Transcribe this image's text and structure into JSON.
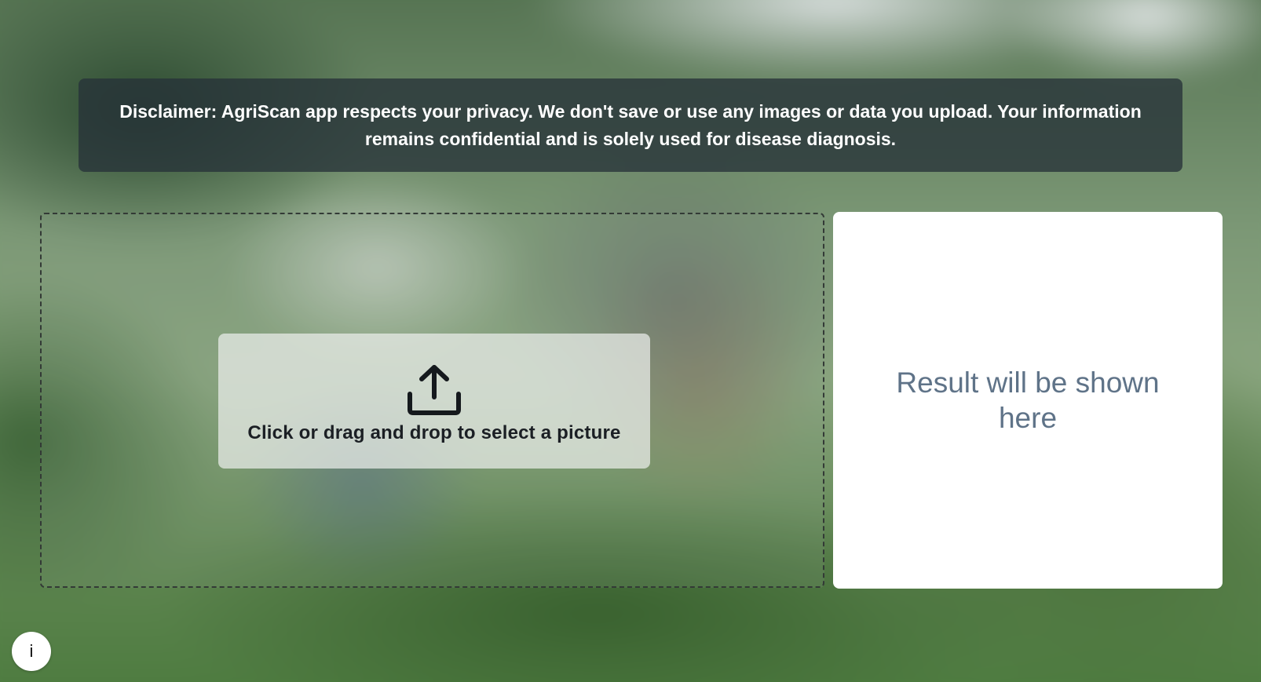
{
  "disclaimer": {
    "text": "Disclaimer: AgriScan app respects your privacy. We don't save or use any images or data you upload. Your information remains confidential and is solely used for disease diagnosis."
  },
  "upload": {
    "icon": "upload-icon",
    "label": "Click or drag and drop to select a picture"
  },
  "result": {
    "placeholder": "Result will be shown here"
  },
  "info_button": {
    "label": "i"
  },
  "colors": {
    "disclaimer_bg": "#263238",
    "result_text": "#5f7388",
    "upload_text": "#1b1f24"
  }
}
